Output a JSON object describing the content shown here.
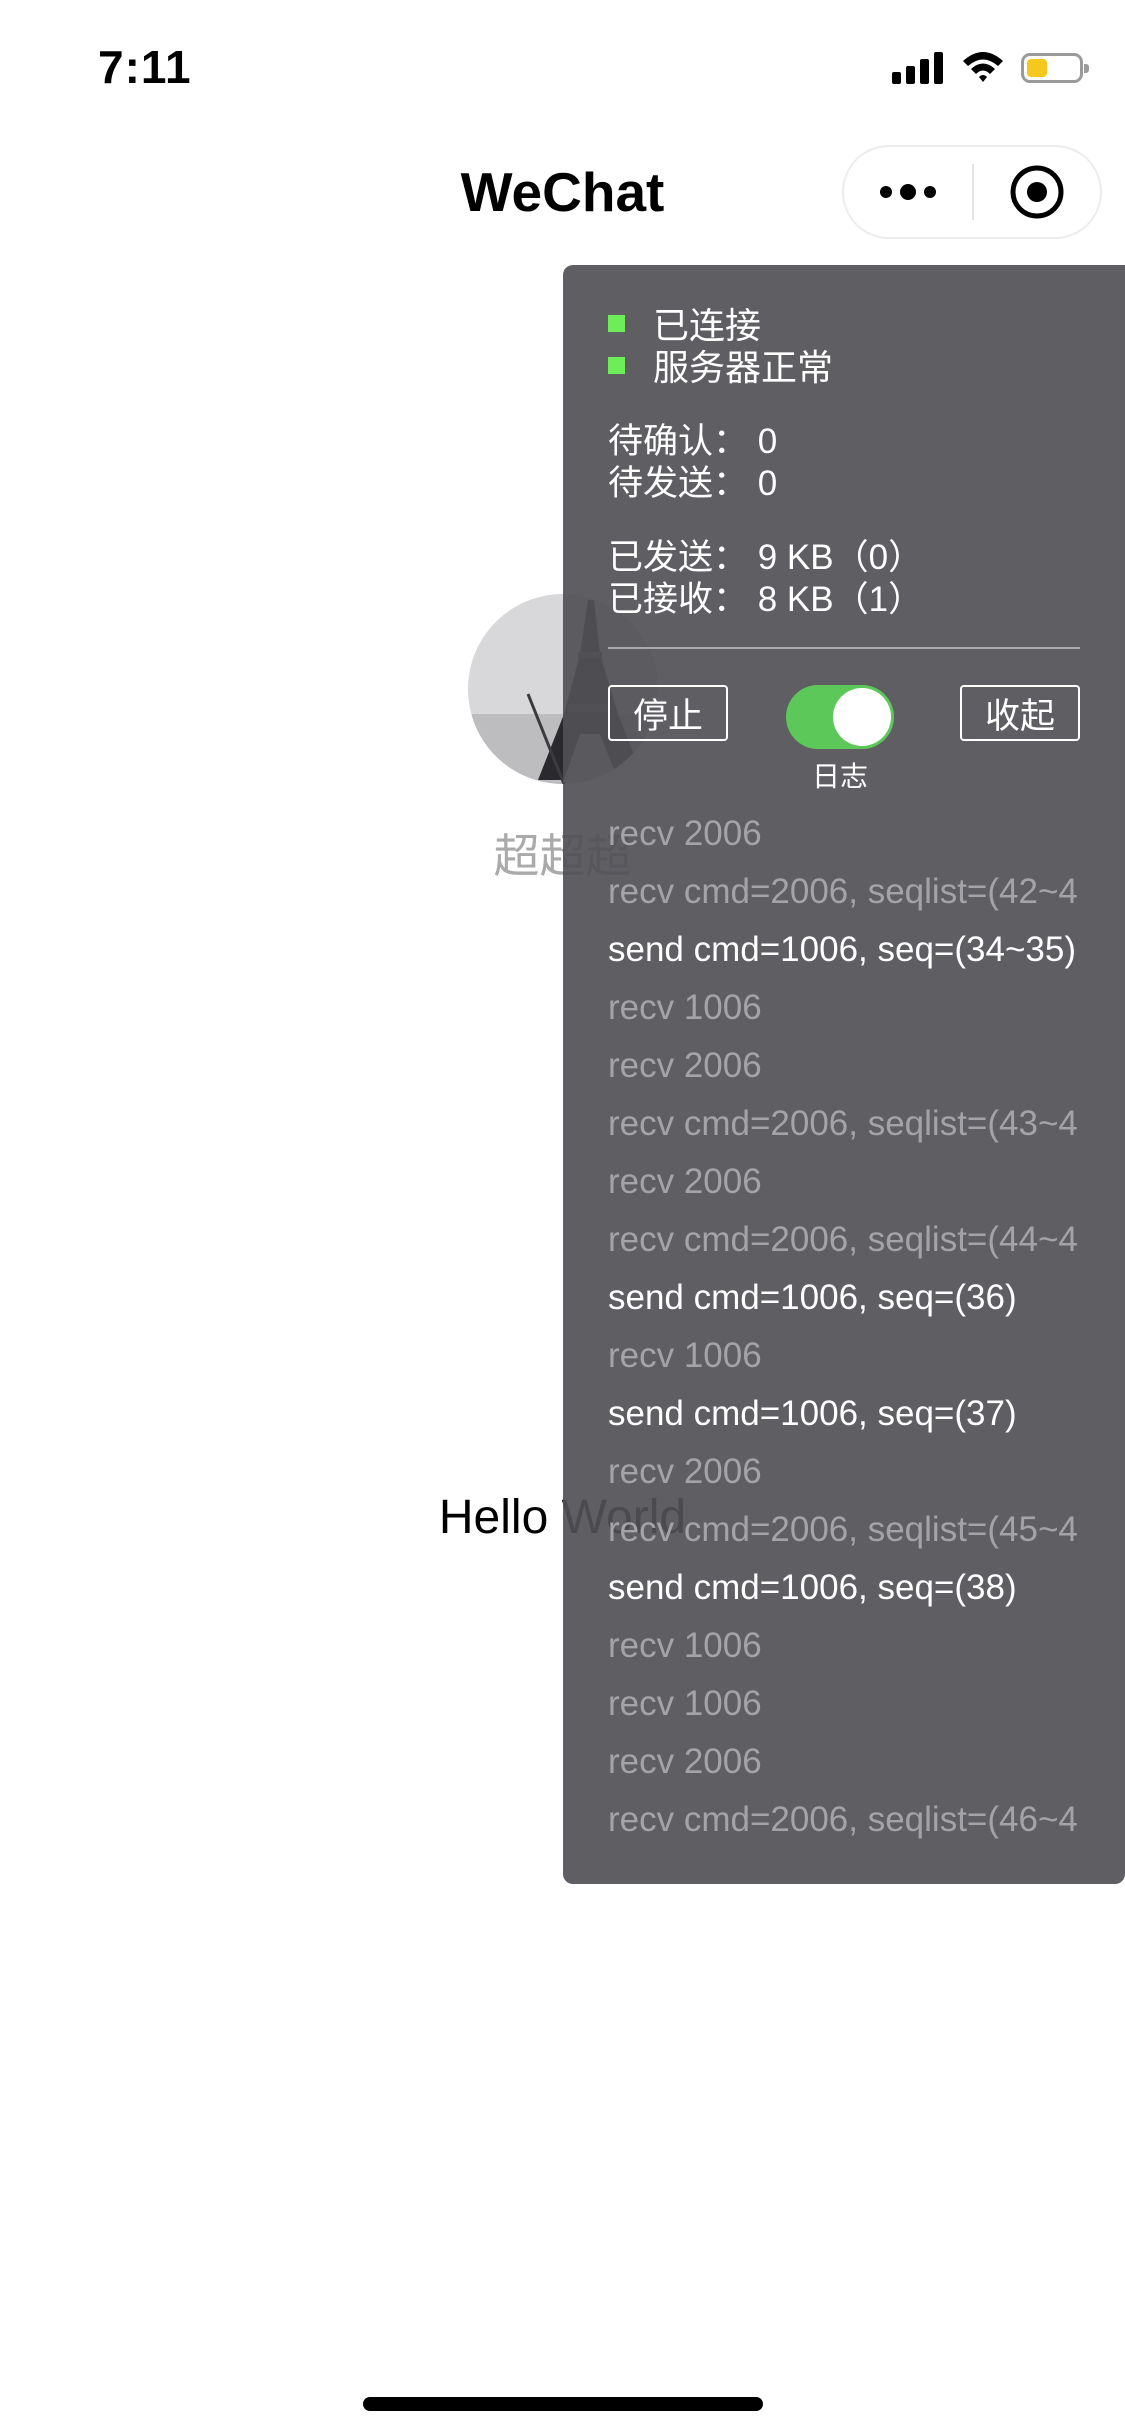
{
  "status_bar": {
    "time": "7:11",
    "icons": [
      "signal-icon",
      "wifi-icon",
      "battery-icon"
    ],
    "battery_color": "#f4c81c",
    "battery_level": 0.4
  },
  "nav": {
    "title": "WeChat",
    "icons": [
      "more-icon",
      "close-target-icon"
    ]
  },
  "profile": {
    "nickname": "超超超",
    "avatar_description_icon": "eiffel-tower-avatar"
  },
  "main": {
    "greeting": "Hello World"
  },
  "debug_panel": {
    "status": {
      "connected": "已连接",
      "server_ok": "服务器正常",
      "indicator_color": "#6ded58"
    },
    "stats": {
      "pending_confirm": "待确认：  0",
      "pending_send": "待发送：  0",
      "sent": "已发送：  9 KB（0）",
      "received": "已接收：  8 KB（1）"
    },
    "buttons": {
      "stop": "停止",
      "collapse": "收起",
      "log_toggle_label": "日志",
      "log_toggle_on": true
    },
    "logs": [
      {
        "type": "recv",
        "text": "recv 2006"
      },
      {
        "type": "recv",
        "text": "recv cmd=2006, seqlist=(42~4"
      },
      {
        "type": "send",
        "text": "send cmd=1006, seq=(34~35)"
      },
      {
        "type": "recv",
        "text": "recv 1006"
      },
      {
        "type": "recv",
        "text": "recv 2006"
      },
      {
        "type": "recv",
        "text": "recv cmd=2006, seqlist=(43~4"
      },
      {
        "type": "recv",
        "text": "recv 2006"
      },
      {
        "type": "recv",
        "text": "recv cmd=2006, seqlist=(44~4"
      },
      {
        "type": "send",
        "text": "send cmd=1006, seq=(36)"
      },
      {
        "type": "recv",
        "text": "recv 1006"
      },
      {
        "type": "send",
        "text": "send cmd=1006, seq=(37)"
      },
      {
        "type": "recv",
        "text": "recv 2006"
      },
      {
        "type": "recv",
        "text": "recv cmd=2006, seqlist=(45~4"
      },
      {
        "type": "send",
        "text": "send cmd=1006, seq=(38)"
      },
      {
        "type": "recv",
        "text": "recv 1006"
      },
      {
        "type": "recv",
        "text": "recv 1006"
      },
      {
        "type": "recv",
        "text": "recv 2006"
      },
      {
        "type": "recv",
        "text": "recv cmd=2006, seqlist=(46~4"
      }
    ]
  }
}
